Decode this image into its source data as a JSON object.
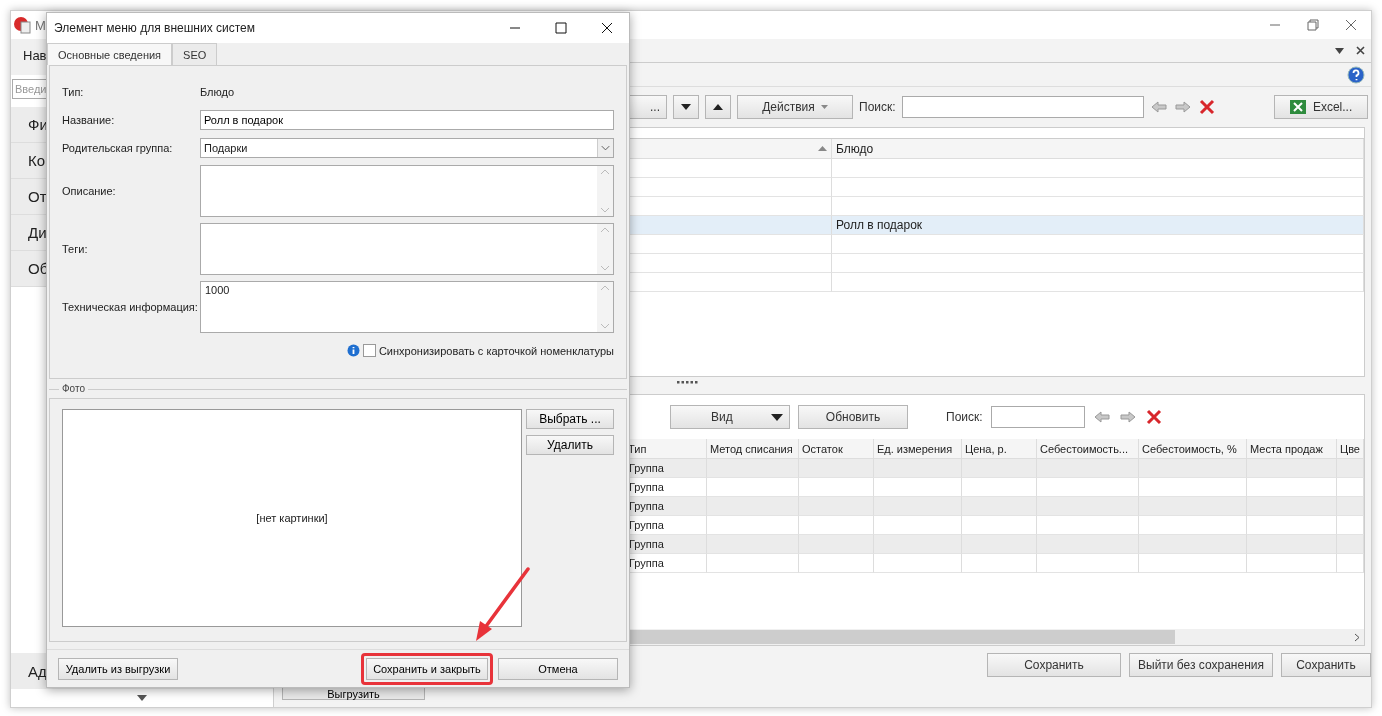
{
  "main_window": {
    "title": "М",
    "sidebar": {
      "heading": "Нав",
      "search_placeholder": "Введи",
      "items": [
        "Фи",
        "Ко",
        "От",
        "Ди",
        "Об"
      ],
      "footer_item": "Ад"
    },
    "toolbar": {
      "partial_button": "...",
      "actions": "Действия",
      "search_label": "Поиск:",
      "excel": "Excel..."
    },
    "upper_grid": {
      "columns": [
        "Блюдо"
      ],
      "rows": [
        {
          "selected": false
        },
        {
          "selected": false
        },
        {
          "selected": false
        },
        {
          "dish": "Ролл в подарок",
          "selected": true
        },
        {
          "selected": false
        },
        {
          "selected": false
        },
        {
          "selected": false
        }
      ]
    },
    "lower_toolbar": {
      "view": "Вид",
      "refresh": "Обновить",
      "search_label": "Поиск:"
    },
    "lower_grid": {
      "columns": [
        "Тип",
        "Метод списания",
        "Остаток",
        "Ед. измерения",
        "Цена, р.",
        "Себестоимость...",
        "Себестоимость, %",
        "Места продаж",
        "Цве"
      ],
      "rows": [
        {
          "type": "Группа"
        },
        {
          "type": "Группа"
        },
        {
          "type": "Группа"
        },
        {
          "type": "Группа"
        },
        {
          "type": "Группа"
        },
        {
          "type": "Группа"
        }
      ]
    },
    "unload_button": "Выгрузить",
    "footer_buttons": [
      "Сохранить",
      "Выйти без сохранения",
      "Сохранить"
    ]
  },
  "dialog": {
    "title": "Элемент меню для внешних систем",
    "tabs": [
      {
        "label": "Основные сведения",
        "selected": true
      },
      {
        "label": "SEO",
        "selected": false
      }
    ],
    "fields": [
      {
        "kind": "text",
        "label": "Тип:",
        "value": "Блюдо"
      },
      {
        "kind": "input",
        "label": "Название:",
        "value": "Ролл в подарок"
      },
      {
        "kind": "select",
        "label": "Родительская группа:",
        "value": "Подарки"
      },
      {
        "kind": "textarea",
        "label": "Описание:"
      },
      {
        "kind": "textarea",
        "label": "Теги:"
      },
      {
        "kind": "textarea",
        "label": "Техническая информация:",
        "value": "1000"
      }
    ],
    "sync": {
      "label": "Синхронизировать с карточкой номенклатуры",
      "checked": false
    },
    "photo": {
      "title": "Фото",
      "placeholder": "[нет картинки]",
      "buttons": [
        "Выбрать ...",
        "Удалить"
      ]
    },
    "footer_buttons": [
      {
        "label": "Удалить из выгрузки",
        "highlighted": false
      },
      {
        "label": "Сохранить и закрыть",
        "highlighted": true
      },
      {
        "label": "Отмена",
        "highlighted": false
      }
    ]
  }
}
